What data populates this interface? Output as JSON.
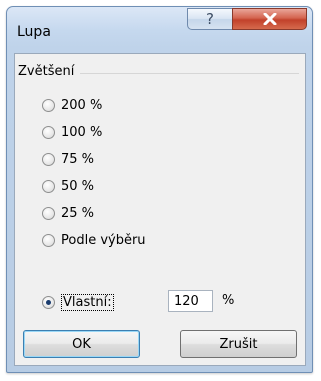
{
  "window": {
    "title": "Lupa",
    "help_glyph": "?",
    "close_icon": "close-icon"
  },
  "group": {
    "label": "Zvětšení"
  },
  "options": [
    {
      "label": "200 %",
      "selected": false
    },
    {
      "label": "100 %",
      "selected": false
    },
    {
      "label": "75 %",
      "selected": false
    },
    {
      "label": "50 %",
      "selected": false
    },
    {
      "label": "25 %",
      "selected": false
    },
    {
      "label": "Podle výběru",
      "selected": false
    },
    {
      "label": "Vlastní:",
      "selected": true
    }
  ],
  "custom": {
    "value": "120",
    "unit": "%"
  },
  "buttons": {
    "ok": "OK",
    "cancel": "Zrušit"
  },
  "colors": {
    "close_button": "#c94a34",
    "default_button_border": "#3c7fb1"
  }
}
